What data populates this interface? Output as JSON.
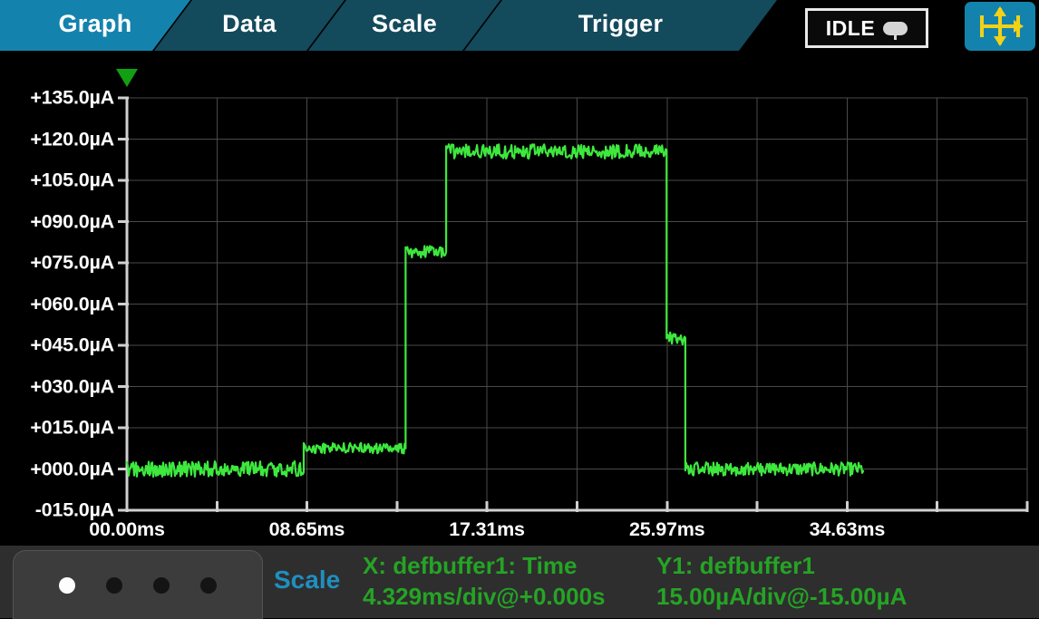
{
  "tabs": [
    {
      "label": "Graph",
      "state": "active"
    },
    {
      "label": "Data",
      "state": "idle"
    },
    {
      "label": "Scale",
      "state": "idle"
    },
    {
      "label": "Trigger",
      "state": "idle"
    }
  ],
  "status": {
    "label": "IDLE",
    "icon": "lamp-icon"
  },
  "toolbar": {
    "pan_zoom_icon": "pan-zoom-arrows-icon"
  },
  "bottom": {
    "page_dots": 4,
    "active_dot": 0,
    "scale_label": "Scale",
    "x_channel": "X: defbuffer1: Time",
    "x_scale": "4.329ms/div@+0.000s",
    "y_channel": "Y1: defbuffer1",
    "y_scale": "15.00µA/div@-15.00µA"
  },
  "colors": {
    "tab_active": "#1383ad",
    "tab_idle": "#134a5c",
    "trace": "#3ee83e",
    "grid": "#4a4a4a",
    "axis": "#d0d0d0",
    "text_green": "#25a425",
    "text_blue": "#1f8fc0",
    "background": "#000000",
    "marker": "#12a012"
  },
  "chart_data": {
    "type": "line",
    "title": "",
    "xlabel": "",
    "ylabel": "",
    "x_unit": "ms",
    "y_unit": "µA",
    "xlim": [
      0.0,
      43.29
    ],
    "ylim": [
      -15.0,
      135.0
    ],
    "x_div": 4.329,
    "y_div": 15.0,
    "grid": true,
    "x_ticks": [
      0.0,
      8.65,
      17.31,
      25.97,
      34.63
    ],
    "x_ticklabels": [
      "00.00ms",
      "08.65ms",
      "17.31ms",
      "25.97ms",
      "34.63ms"
    ],
    "y_ticks": [
      135.0,
      120.0,
      105.0,
      90.0,
      75.0,
      60.0,
      45.0,
      30.0,
      15.0,
      0.0,
      -15.0
    ],
    "y_ticklabels": [
      "+135.0µA",
      "+120.0µA",
      "+105.0µA",
      "+090.0µA",
      "+075.0µA",
      "+060.0µA",
      "+045.0µA",
      "+030.0µA",
      "+015.0µA",
      "+000.0µA",
      "-015.0µA"
    ],
    "series": [
      {
        "name": "defbuffer1",
        "color": "#3ee83e",
        "noise_amplitude_uA": 2.6,
        "steps": [
          {
            "t_start": 0.0,
            "t_end": 8.5,
            "level_uA": 0.0,
            "noise_uA": 2.8
          },
          {
            "t_start": 8.5,
            "t_end": 13.4,
            "level_uA": 7.5,
            "noise_uA": 2.0
          },
          {
            "t_start": 13.4,
            "t_end": 15.35,
            "level_uA": 79.0,
            "noise_uA": 2.2
          },
          {
            "t_start": 15.35,
            "t_end": 25.95,
            "level_uA": 115.5,
            "noise_uA": 2.6
          },
          {
            "t_start": 25.95,
            "t_end": 26.85,
            "level_uA": 47.5,
            "noise_uA": 2.4
          },
          {
            "t_start": 26.85,
            "t_end": 35.4,
            "level_uA": 0.0,
            "noise_uA": 2.4
          }
        ]
      }
    ],
    "marker": {
      "name": "trigger-marker",
      "t": 0.0,
      "shape": "down-triangle"
    }
  }
}
